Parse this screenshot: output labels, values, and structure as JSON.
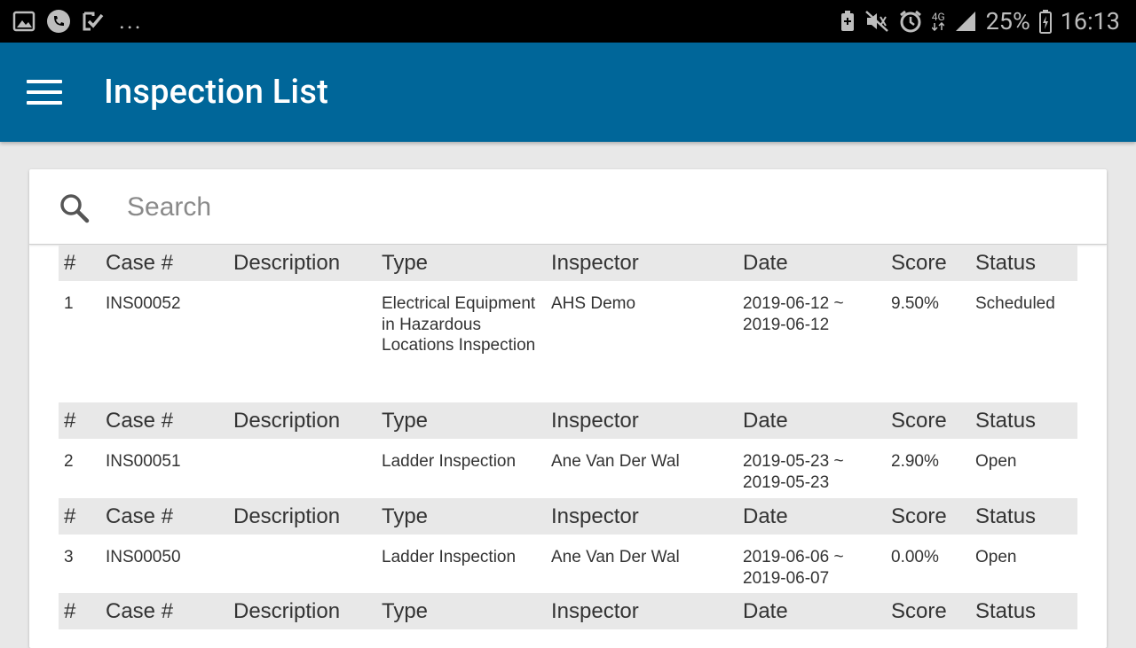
{
  "status_bar": {
    "battery": "25%",
    "time": "16:13",
    "network": "4G",
    "more": "..."
  },
  "app_bar": {
    "title": "Inspection List"
  },
  "search": {
    "placeholder": "Search",
    "value": ""
  },
  "table": {
    "columns": [
      "#",
      "Case #",
      "Description",
      "Type",
      "Inspector",
      "Date",
      "Score",
      "Status"
    ],
    "rows": [
      {
        "num": "1",
        "case": "INS00052",
        "description": "",
        "type": "Electrical Equipment in Hazardous Locations Inspection",
        "inspector": "AHS Demo",
        "date": "2019-06-12 ~ 2019-06-12",
        "score": "9.50%",
        "status": "Scheduled"
      },
      {
        "num": "2",
        "case": "INS00051",
        "description": "",
        "type": "Ladder Inspection",
        "inspector": "Ane Van Der Wal",
        "date": "2019-05-23 ~ 2019-05-23",
        "score": "2.90%",
        "status": "Open"
      },
      {
        "num": "3",
        "case": "INS00050",
        "description": "",
        "type": "Ladder Inspection",
        "inspector": "Ane Van Der Wal",
        "date": "2019-06-06 ~ 2019-06-07",
        "score": "0.00%",
        "status": "Open"
      }
    ]
  },
  "colors": {
    "app_bar": "#006699",
    "header_bg": "#e8e8e8",
    "page_bg": "#e8e8e8"
  }
}
